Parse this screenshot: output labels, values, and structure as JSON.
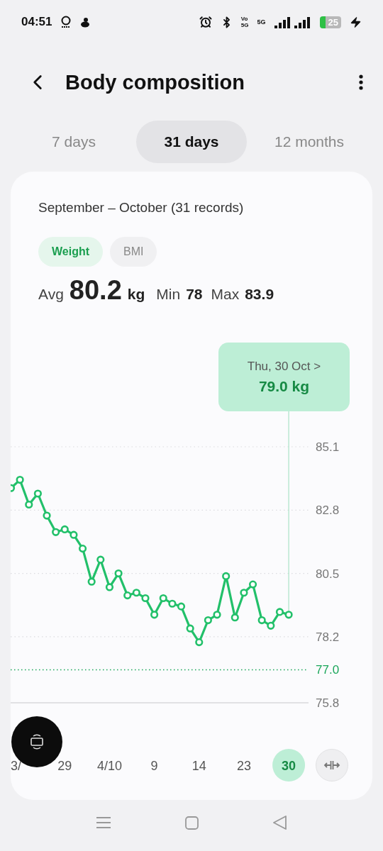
{
  "status_bar": {
    "time": "04:51",
    "sim_top": "Vo",
    "sim_bottom": "5G",
    "network": "5G",
    "battery": "25"
  },
  "header": {
    "title": "Body composition"
  },
  "tabs": [
    {
      "label": "7 days",
      "selected": false
    },
    {
      "label": "31 days",
      "selected": true
    },
    {
      "label": "12 months",
      "selected": false
    }
  ],
  "card": {
    "period": "September – October (31 records)",
    "metrics": [
      {
        "label": "Weight",
        "selected": true
      },
      {
        "label": "BMI",
        "selected": false
      }
    ],
    "stats": {
      "avg_label": "Avg",
      "avg_value": "80.2",
      "unit": "kg",
      "min_label": "Min",
      "min_value": "78",
      "max_label": "Max",
      "max_value": "83.9"
    },
    "tooltip": {
      "date": "Thu, 30 Oct",
      "chevron": ">",
      "value": "79.0 kg"
    },
    "chart_data": {
      "type": "line",
      "grid": true,
      "categories": [
        null,
        "3/",
        null,
        null,
        null,
        null,
        "29",
        null,
        null,
        null,
        null,
        "4/10",
        null,
        null,
        null,
        null,
        "9",
        null,
        null,
        null,
        null,
        "14",
        null,
        null,
        null,
        null,
        "23",
        null,
        null,
        null,
        null,
        "30"
      ],
      "series": [
        {
          "color": "#22c06a",
          "marker": "o",
          "values": [
            83.6,
            83.9,
            83.0,
            83.4,
            82.6,
            82.0,
            82.1,
            81.9,
            81.4,
            80.2,
            81.0,
            80.0,
            80.5,
            79.7,
            79.8,
            79.6,
            79.0,
            79.6,
            79.4,
            79.3,
            78.5,
            78.0,
            78.8,
            79.0,
            80.4,
            78.9,
            79.8,
            80.1,
            78.8,
            78.6,
            79.1,
            79.0
          ]
        }
      ],
      "ylim": [
        75.8,
        85.1
      ],
      "yticks": [
        {
          "value": 85.1,
          "label": "85.1"
        },
        {
          "value": 82.8,
          "label": "82.8"
        },
        {
          "value": 80.5,
          "label": "80.5"
        },
        {
          "value": 78.2,
          "label": "78.2"
        },
        {
          "value": 77.0,
          "label": "77.0"
        },
        {
          "value": 75.8,
          "label": "75.8"
        }
      ],
      "ref_lines": [
        {
          "axis": "y",
          "value": 77.0,
          "color": "#1aa65a"
        }
      ],
      "annotations": [
        {
          "x": "30"
        }
      ]
    }
  }
}
